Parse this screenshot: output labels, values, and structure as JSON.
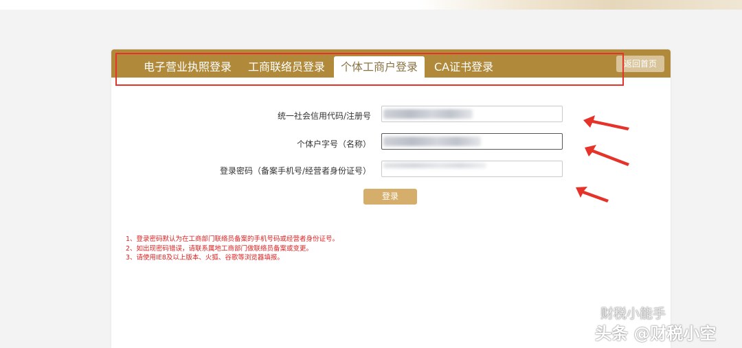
{
  "tabs": [
    {
      "label": "电子营业执照登录",
      "active": false
    },
    {
      "label": "工商联络员登录",
      "active": false
    },
    {
      "label": "个体工商户登录",
      "active": true
    },
    {
      "label": "CA证书登录",
      "active": false
    }
  ],
  "home_button": "返回首页",
  "form": {
    "credit_code_label": "统一社会信用代码/注册号",
    "name_label": "个体户字号（名称）",
    "password_label": "登录密码（备案手机号/经营者身份证号）",
    "login_button": "登录"
  },
  "notes": [
    "1、登录密码默认为在工商部门联络员备案的手机号码或经营者身份证号。",
    "2、如出现密码错误，请联系属地工商部门做联络员备案或变更。",
    "3、请使用IE8及以上版本、火狐、谷歌等浏览器填报。"
  ],
  "watermark": {
    "line1": "财税小能手",
    "line2": "头条 @财税小空"
  },
  "colors": {
    "tab_bar": "#b08a3a",
    "annotation_red": "#e6332a",
    "note_red": "#e02020",
    "login_button": "#d4ae6a"
  }
}
